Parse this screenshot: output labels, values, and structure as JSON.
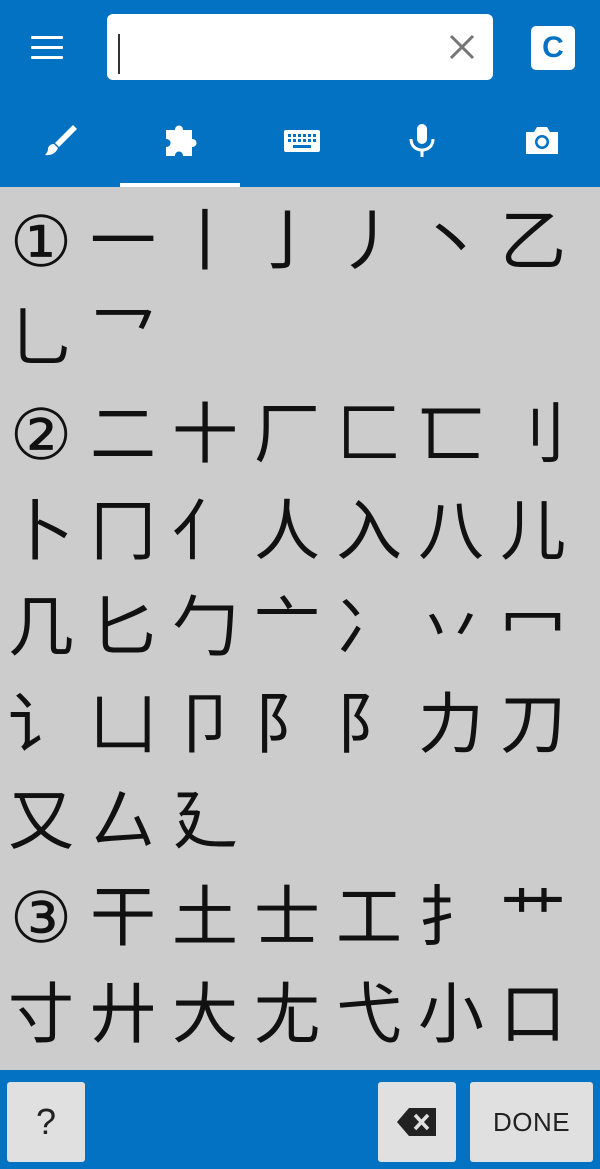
{
  "header": {
    "search": {
      "value": "",
      "placeholder": ""
    },
    "c_button_label": "C"
  },
  "tabs": [
    {
      "name": "handwriting",
      "icon": "brush-icon",
      "selected": false
    },
    {
      "name": "radicals",
      "icon": "puzzle-icon",
      "selected": true
    },
    {
      "name": "keyboard",
      "icon": "keyboard-icon",
      "selected": false
    },
    {
      "name": "voice",
      "icon": "mic-icon",
      "selected": false
    },
    {
      "name": "camera",
      "icon": "camera-icon",
      "selected": false
    }
  ],
  "radicals": [
    [
      "①",
      "一",
      "丨",
      "亅",
      "丿",
      "丶",
      "乙"
    ],
    [
      "乚",
      "乛"
    ],
    [
      "②",
      "二",
      "十",
      "厂",
      "匚",
      "匸",
      "刂"
    ],
    [
      "卜",
      "冂",
      "亻",
      "人",
      "入",
      "八",
      "儿"
    ],
    [
      "几",
      "匕",
      "勹",
      "亠",
      "冫",
      "丷",
      "冖"
    ],
    [
      "讠",
      "凵",
      "卩",
      "阝",
      "阝",
      "力",
      "刀"
    ],
    [
      "又",
      "厶",
      "廴"
    ],
    [
      "③",
      "干",
      "土",
      "士",
      "工",
      "扌",
      "艹"
    ],
    [
      "寸",
      "廾",
      "大",
      "尢",
      "弋",
      "小",
      "口"
    ]
  ],
  "footer": {
    "help_label": "?",
    "done_label": "DONE"
  },
  "colors": {
    "primary": "#0372c2",
    "background": "#cccccc",
    "button": "#e0e0e0"
  }
}
